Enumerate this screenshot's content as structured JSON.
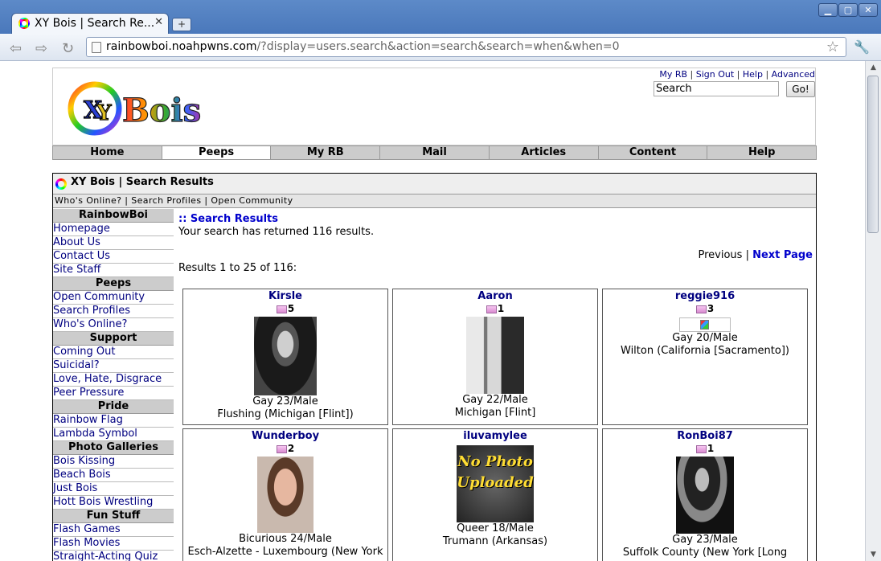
{
  "browser": {
    "tab_title": "XY Bois | Search Re...",
    "url_host": "rainbowboi.noahpwns.com",
    "url_path": "/?display=users.search&action=search&search=when&when=0"
  },
  "header": {
    "logo_text": "XY Bois",
    "links": [
      "My RB",
      "Sign Out",
      "Help",
      "Advanced"
    ],
    "search_value": "Search",
    "go_label": "Go!"
  },
  "nav": [
    "Home",
    "Peeps",
    "My RB",
    "Mail",
    "Articles",
    "Content",
    "Help"
  ],
  "box": {
    "title": "XY Bois | Search Results",
    "subnav": "Who's Online? | Search Profiles | Open Community"
  },
  "sidebar": [
    {
      "title": "RainbowBoi",
      "items": [
        "Homepage",
        "About Us",
        "Contact Us",
        "Site Staff"
      ]
    },
    {
      "title": "Peeps",
      "items": [
        "Open Community",
        "Search Profiles",
        "Who's Online?"
      ]
    },
    {
      "title": "Support",
      "items": [
        "Coming Out",
        "Suicidal?",
        "Love, Hate, Disgrace",
        "Peer Pressure"
      ]
    },
    {
      "title": "Pride",
      "items": [
        "Rainbow Flag",
        "Lambda Symbol"
      ]
    },
    {
      "title": "Photo Galleries",
      "items": [
        "Bois Kissing",
        "Beach Bois",
        "Just Bois",
        "Hott Bois Wrestling"
      ]
    },
    {
      "title": "Fun Stuff",
      "items": [
        "Flash Games",
        "Flash Movies",
        "Straight-Acting Quiz"
      ]
    }
  ],
  "results": {
    "heading": ":: Search Results",
    "count_text": "Your search has returned 116 results.",
    "previous_label": "Previous",
    "next_label": "Next Page",
    "range_text": "Results 1 to 25 of 116:",
    "photo_placeholder_text": "No Photo Uploaded",
    "users": [
      {
        "name": "Kirsle",
        "pics": "5",
        "line1": "Gay 23/Male",
        "line2": "Flushing (Michigan [Flint])"
      },
      {
        "name": "Aaron",
        "pics": "1",
        "line1": "Gay 22/Male",
        "line2": "Michigan [Flint]"
      },
      {
        "name": "reggie916",
        "pics": "3",
        "line1": "Gay 20/Male",
        "line2": "Wilton (California [Sacramento])"
      },
      {
        "name": "Wunderboy",
        "pics": "2",
        "line1": "Bicurious 24/Male",
        "line2": "Esch-Alzette - Luxembourg (New York"
      },
      {
        "name": "iluvamylee",
        "pics": "",
        "line1": "Queer 18/Male",
        "line2": "Trumann (Arkansas)"
      },
      {
        "name": "RonBoi87",
        "pics": "1",
        "line1": "Gay 23/Male",
        "line2": "Suffolk County (New York [Long"
      }
    ]
  }
}
